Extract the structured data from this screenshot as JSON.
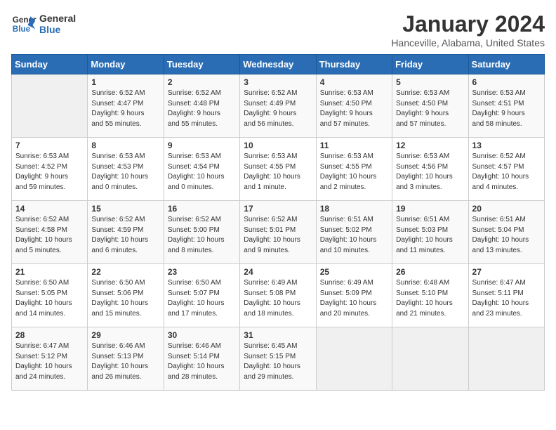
{
  "logo": {
    "line1": "General",
    "line2": "Blue"
  },
  "title": "January 2024",
  "subtitle": "Hanceville, Alabama, United States",
  "weekdays": [
    "Sunday",
    "Monday",
    "Tuesday",
    "Wednesday",
    "Thursday",
    "Friday",
    "Saturday"
  ],
  "weeks": [
    [
      {
        "day": "",
        "info": ""
      },
      {
        "day": "1",
        "info": "Sunrise: 6:52 AM\nSunset: 4:47 PM\nDaylight: 9 hours\nand 55 minutes."
      },
      {
        "day": "2",
        "info": "Sunrise: 6:52 AM\nSunset: 4:48 PM\nDaylight: 9 hours\nand 55 minutes."
      },
      {
        "day": "3",
        "info": "Sunrise: 6:52 AM\nSunset: 4:49 PM\nDaylight: 9 hours\nand 56 minutes."
      },
      {
        "day": "4",
        "info": "Sunrise: 6:53 AM\nSunset: 4:50 PM\nDaylight: 9 hours\nand 57 minutes."
      },
      {
        "day": "5",
        "info": "Sunrise: 6:53 AM\nSunset: 4:50 PM\nDaylight: 9 hours\nand 57 minutes."
      },
      {
        "day": "6",
        "info": "Sunrise: 6:53 AM\nSunset: 4:51 PM\nDaylight: 9 hours\nand 58 minutes."
      }
    ],
    [
      {
        "day": "7",
        "info": "Sunrise: 6:53 AM\nSunset: 4:52 PM\nDaylight: 9 hours\nand 59 minutes."
      },
      {
        "day": "8",
        "info": "Sunrise: 6:53 AM\nSunset: 4:53 PM\nDaylight: 10 hours\nand 0 minutes."
      },
      {
        "day": "9",
        "info": "Sunrise: 6:53 AM\nSunset: 4:54 PM\nDaylight: 10 hours\nand 0 minutes."
      },
      {
        "day": "10",
        "info": "Sunrise: 6:53 AM\nSunset: 4:55 PM\nDaylight: 10 hours\nand 1 minute."
      },
      {
        "day": "11",
        "info": "Sunrise: 6:53 AM\nSunset: 4:55 PM\nDaylight: 10 hours\nand 2 minutes."
      },
      {
        "day": "12",
        "info": "Sunrise: 6:53 AM\nSunset: 4:56 PM\nDaylight: 10 hours\nand 3 minutes."
      },
      {
        "day": "13",
        "info": "Sunrise: 6:52 AM\nSunset: 4:57 PM\nDaylight: 10 hours\nand 4 minutes."
      }
    ],
    [
      {
        "day": "14",
        "info": "Sunrise: 6:52 AM\nSunset: 4:58 PM\nDaylight: 10 hours\nand 5 minutes."
      },
      {
        "day": "15",
        "info": "Sunrise: 6:52 AM\nSunset: 4:59 PM\nDaylight: 10 hours\nand 6 minutes."
      },
      {
        "day": "16",
        "info": "Sunrise: 6:52 AM\nSunset: 5:00 PM\nDaylight: 10 hours\nand 8 minutes."
      },
      {
        "day": "17",
        "info": "Sunrise: 6:52 AM\nSunset: 5:01 PM\nDaylight: 10 hours\nand 9 minutes."
      },
      {
        "day": "18",
        "info": "Sunrise: 6:51 AM\nSunset: 5:02 PM\nDaylight: 10 hours\nand 10 minutes."
      },
      {
        "day": "19",
        "info": "Sunrise: 6:51 AM\nSunset: 5:03 PM\nDaylight: 10 hours\nand 11 minutes."
      },
      {
        "day": "20",
        "info": "Sunrise: 6:51 AM\nSunset: 5:04 PM\nDaylight: 10 hours\nand 13 minutes."
      }
    ],
    [
      {
        "day": "21",
        "info": "Sunrise: 6:50 AM\nSunset: 5:05 PM\nDaylight: 10 hours\nand 14 minutes."
      },
      {
        "day": "22",
        "info": "Sunrise: 6:50 AM\nSunset: 5:06 PM\nDaylight: 10 hours\nand 15 minutes."
      },
      {
        "day": "23",
        "info": "Sunrise: 6:50 AM\nSunset: 5:07 PM\nDaylight: 10 hours\nand 17 minutes."
      },
      {
        "day": "24",
        "info": "Sunrise: 6:49 AM\nSunset: 5:08 PM\nDaylight: 10 hours\nand 18 minutes."
      },
      {
        "day": "25",
        "info": "Sunrise: 6:49 AM\nSunset: 5:09 PM\nDaylight: 10 hours\nand 20 minutes."
      },
      {
        "day": "26",
        "info": "Sunrise: 6:48 AM\nSunset: 5:10 PM\nDaylight: 10 hours\nand 21 minutes."
      },
      {
        "day": "27",
        "info": "Sunrise: 6:47 AM\nSunset: 5:11 PM\nDaylight: 10 hours\nand 23 minutes."
      }
    ],
    [
      {
        "day": "28",
        "info": "Sunrise: 6:47 AM\nSunset: 5:12 PM\nDaylight: 10 hours\nand 24 minutes."
      },
      {
        "day": "29",
        "info": "Sunrise: 6:46 AM\nSunset: 5:13 PM\nDaylight: 10 hours\nand 26 minutes."
      },
      {
        "day": "30",
        "info": "Sunrise: 6:46 AM\nSunset: 5:14 PM\nDaylight: 10 hours\nand 28 minutes."
      },
      {
        "day": "31",
        "info": "Sunrise: 6:45 AM\nSunset: 5:15 PM\nDaylight: 10 hours\nand 29 minutes."
      },
      {
        "day": "",
        "info": ""
      },
      {
        "day": "",
        "info": ""
      },
      {
        "day": "",
        "info": ""
      }
    ]
  ]
}
